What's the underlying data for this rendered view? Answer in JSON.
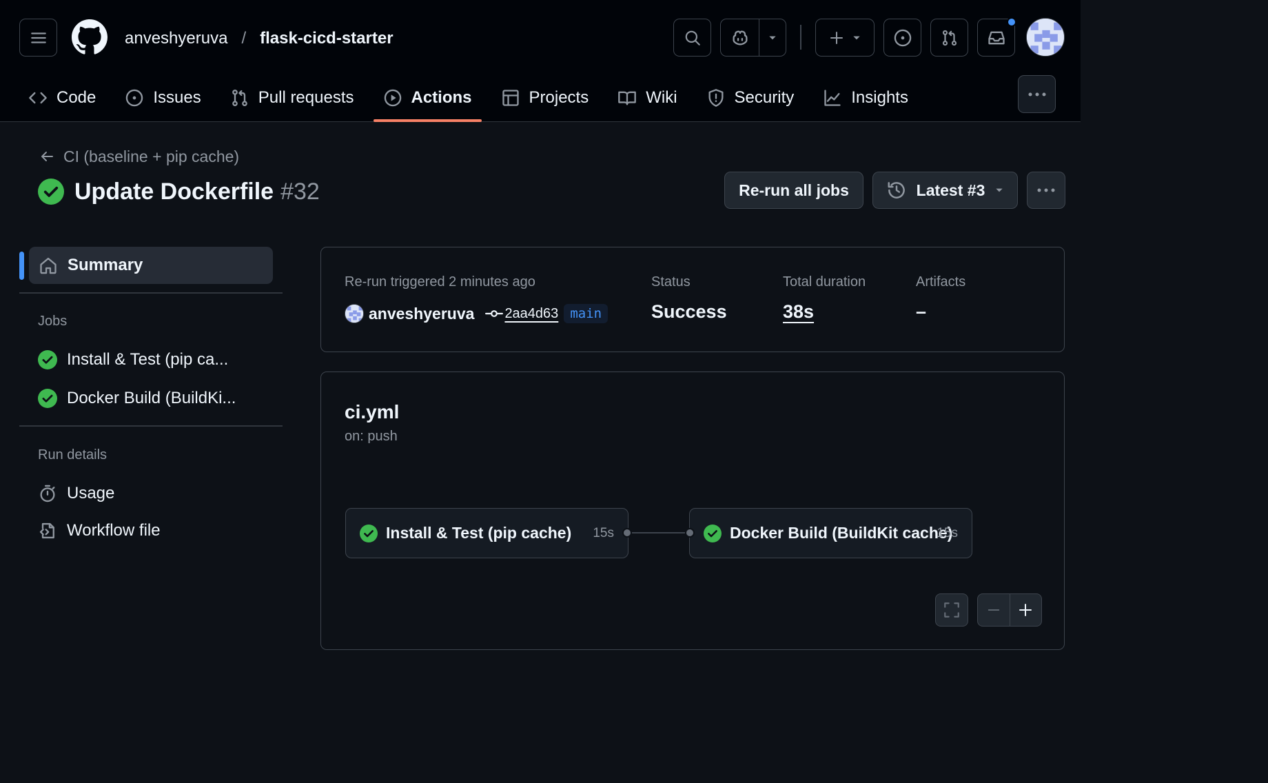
{
  "header": {
    "owner": "anveshyeruva",
    "separator": "/",
    "repo": "flask-cicd-starter"
  },
  "tabs": [
    {
      "label": "Code",
      "icon": "code-icon"
    },
    {
      "label": "Issues",
      "icon": "issue-opened-icon"
    },
    {
      "label": "Pull requests",
      "icon": "git-pull-request-icon"
    },
    {
      "label": "Actions",
      "icon": "play-icon",
      "active": true
    },
    {
      "label": "Projects",
      "icon": "table-icon"
    },
    {
      "label": "Wiki",
      "icon": "book-icon"
    },
    {
      "label": "Security",
      "icon": "shield-icon"
    },
    {
      "label": "Insights",
      "icon": "graph-icon"
    }
  ],
  "run": {
    "workflow_back_label": "CI (baseline + pip cache)",
    "title": "Update Dockerfile",
    "number": "#32",
    "rerun_label": "Re-run all jobs",
    "attempt_label": "Latest #3"
  },
  "sidebar": {
    "summary_label": "Summary",
    "jobs_heading": "Jobs",
    "jobs": [
      {
        "label": "Install & Test (pip ca..."
      },
      {
        "label": "Docker Build (BuildKi..."
      }
    ],
    "run_details_heading": "Run details",
    "usage_label": "Usage",
    "workflow_file_label": "Workflow file"
  },
  "summary": {
    "trigger_text": "Re-run triggered 2 minutes ago",
    "actor": "anveshyeruva",
    "commit_sha": "2aa4d63",
    "branch": "main",
    "status_label": "Status",
    "status_value": "Success",
    "duration_label": "Total duration",
    "duration_value": "38s",
    "artifacts_label": "Artifacts",
    "artifacts_value": "–"
  },
  "graph": {
    "file": "ci.yml",
    "trigger": "on: push",
    "jobs": [
      {
        "name": "Install & Test (pip cache)",
        "duration": "15s"
      },
      {
        "name": "Docker Build (BuildKit cache)",
        "duration": "15s"
      }
    ]
  },
  "colors": {
    "background": "#0d1117",
    "header": "#010409",
    "accent_tab": "#f78166",
    "success": "#3fb950",
    "link": "#4493f8"
  }
}
